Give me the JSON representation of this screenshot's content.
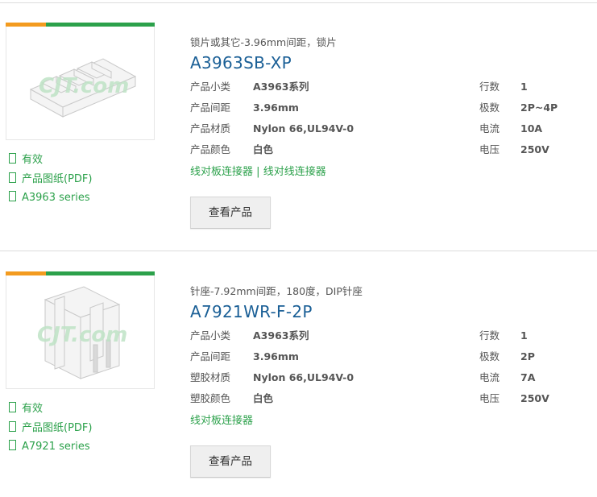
{
  "colors": {
    "accent_green": "#2ca14b",
    "accent_orange": "#f39b1f",
    "title_blue": "#1a5f96"
  },
  "products": [
    {
      "subtitle": "锁片或其它-3.96mm间距，锁片",
      "model": "A3963SB-XP",
      "watermark": "CJT.com",
      "links": [
        "有效",
        "产品图纸(PDF)",
        "A3963 series"
      ],
      "specs_left": [
        {
          "label": "产品小类",
          "value": "A3963系列"
        },
        {
          "label": "产品间距",
          "value": "3.96mm"
        },
        {
          "label": "产品材质",
          "value": "Nylon 66,UL94V-0"
        },
        {
          "label": "产品颜色",
          "value": "白色"
        }
      ],
      "specs_right": [
        {
          "label": "行数",
          "value": "1"
        },
        {
          "label": "极数",
          "value": "2P~4P"
        },
        {
          "label": "电流",
          "value": "10A"
        },
        {
          "label": "电压",
          "value": "250V"
        }
      ],
      "categories": [
        "线对板连接器",
        "线对线连接器"
      ],
      "category_sep": "|",
      "button": "查看产品"
    },
    {
      "subtitle": "针座-7.92mm间距，180度，DIP针座",
      "model": "A7921WR-F-2P",
      "watermark": "CJT.com",
      "links": [
        "有效",
        "产品图纸(PDF)",
        "A7921 series"
      ],
      "specs_left": [
        {
          "label": "产品小类",
          "value": "A3963系列"
        },
        {
          "label": "产品间距",
          "value": "3.96mm"
        },
        {
          "label": "塑胶材质",
          "value": "Nylon 66,UL94V-0"
        },
        {
          "label": "塑胶颜色",
          "value": "白色"
        }
      ],
      "specs_right": [
        {
          "label": "行数",
          "value": "1"
        },
        {
          "label": "极数",
          "value": "2P"
        },
        {
          "label": "电流",
          "value": "7A"
        },
        {
          "label": "电压",
          "value": "250V"
        }
      ],
      "categories": [
        "线对板连接器"
      ],
      "category_sep": "",
      "button": "查看产品"
    }
  ]
}
